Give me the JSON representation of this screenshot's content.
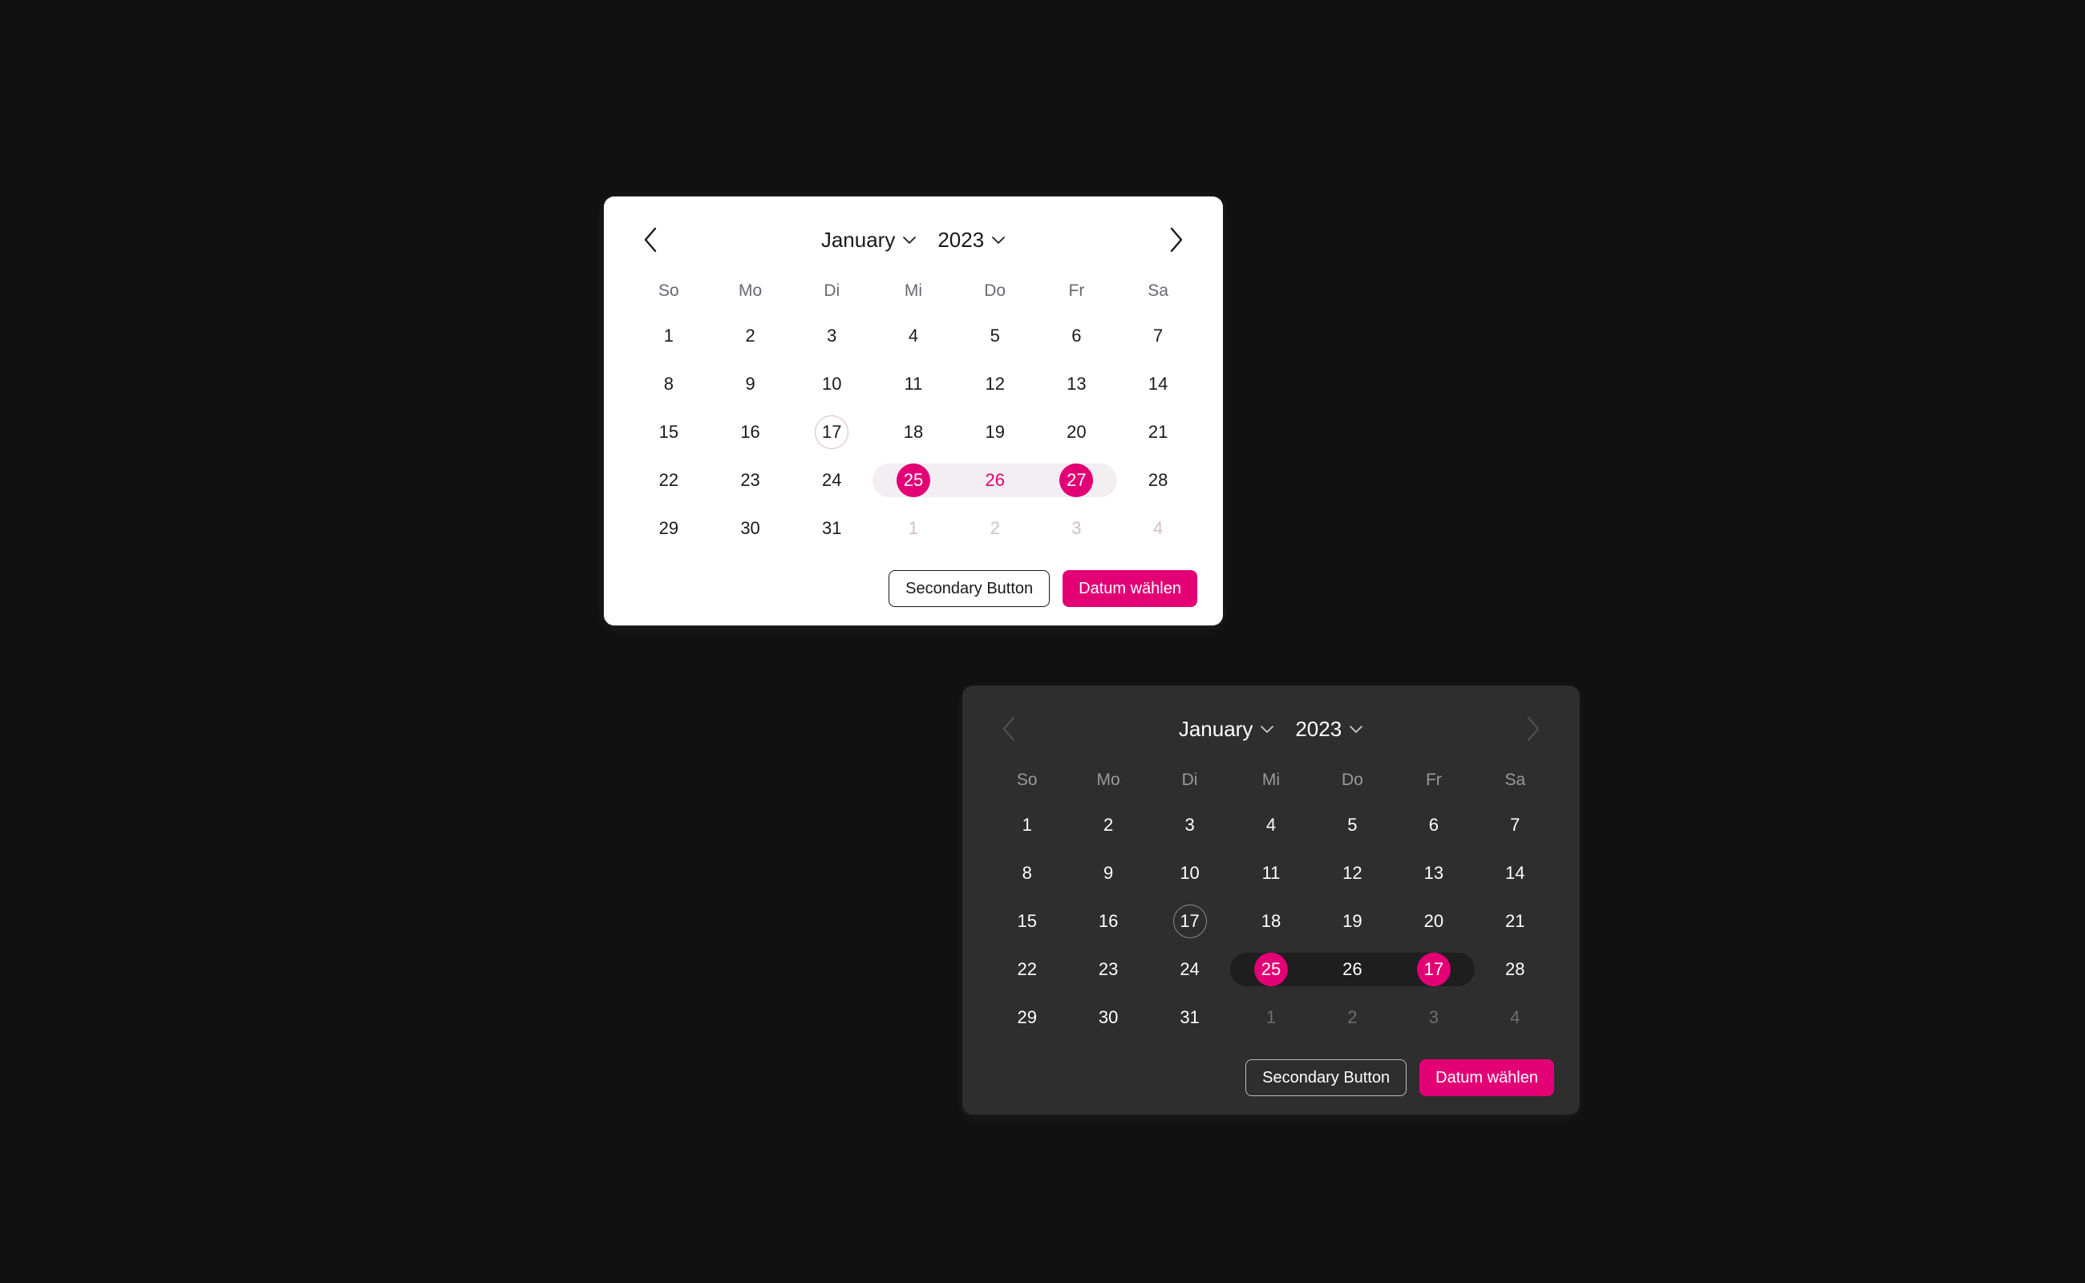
{
  "theme": {
    "page_background": "#111111",
    "accent": "#e20074",
    "light_card_background": "#ffffff",
    "dark_card_background": "#2e2e2e",
    "light_range_band": "#f3eef2",
    "dark_range_band": "#1e1e1e"
  },
  "weekdays": [
    "So",
    "Mo",
    "Di",
    "Mi",
    "Do",
    "Fr",
    "Sa"
  ],
  "icons": {
    "prev": "chevron-left-icon",
    "next": "chevron-right-icon",
    "dropdown": "chevron-down-icon"
  },
  "light_picker": {
    "header": {
      "month": "January",
      "year": "2023",
      "prev_label": "‹",
      "next_label": "›"
    },
    "weeks": [
      [
        {
          "label": "1",
          "state": "normal"
        },
        {
          "label": "2",
          "state": "normal"
        },
        {
          "label": "3",
          "state": "normal"
        },
        {
          "label": "4",
          "state": "normal"
        },
        {
          "label": "5",
          "state": "normal"
        },
        {
          "label": "6",
          "state": "normal"
        },
        {
          "label": "7",
          "state": "normal"
        }
      ],
      [
        {
          "label": "8",
          "state": "normal"
        },
        {
          "label": "9",
          "state": "normal"
        },
        {
          "label": "10",
          "state": "normal"
        },
        {
          "label": "11",
          "state": "normal"
        },
        {
          "label": "12",
          "state": "normal"
        },
        {
          "label": "13",
          "state": "normal"
        },
        {
          "label": "14",
          "state": "normal"
        }
      ],
      [
        {
          "label": "15",
          "state": "normal"
        },
        {
          "label": "16",
          "state": "normal"
        },
        {
          "label": "17",
          "state": "today"
        },
        {
          "label": "18",
          "state": "normal"
        },
        {
          "label": "19",
          "state": "normal"
        },
        {
          "label": "20",
          "state": "normal"
        },
        {
          "label": "21",
          "state": "normal"
        }
      ],
      [
        {
          "label": "22",
          "state": "normal"
        },
        {
          "label": "23",
          "state": "normal"
        },
        {
          "label": "24",
          "state": "normal"
        },
        {
          "label": "25",
          "state": "endpoint"
        },
        {
          "label": "26",
          "state": "range"
        },
        {
          "label": "27",
          "state": "endpoint"
        },
        {
          "label": "28",
          "state": "normal"
        }
      ],
      [
        {
          "label": "29",
          "state": "normal"
        },
        {
          "label": "30",
          "state": "normal"
        },
        {
          "label": "31",
          "state": "normal"
        },
        {
          "label": "1",
          "state": "muted"
        },
        {
          "label": "2",
          "state": "muted"
        },
        {
          "label": "3",
          "state": "muted"
        },
        {
          "label": "4",
          "state": "muted"
        }
      ]
    ],
    "range_row_index": 3,
    "range_start_col": 3,
    "range_end_col": 5,
    "footer": {
      "secondary_label": "Secondary Button",
      "primary_label": "Datum wählen"
    }
  },
  "dark_picker": {
    "header": {
      "month": "January",
      "year": "2023",
      "prev_label": "‹",
      "next_label": "›"
    },
    "weeks": [
      [
        {
          "label": "1",
          "state": "normal"
        },
        {
          "label": "2",
          "state": "normal"
        },
        {
          "label": "3",
          "state": "normal"
        },
        {
          "label": "4",
          "state": "normal"
        },
        {
          "label": "5",
          "state": "normal"
        },
        {
          "label": "6",
          "state": "normal"
        },
        {
          "label": "7",
          "state": "normal"
        }
      ],
      [
        {
          "label": "8",
          "state": "normal"
        },
        {
          "label": "9",
          "state": "normal"
        },
        {
          "label": "10",
          "state": "normal"
        },
        {
          "label": "11",
          "state": "normal"
        },
        {
          "label": "12",
          "state": "normal"
        },
        {
          "label": "13",
          "state": "normal"
        },
        {
          "label": "14",
          "state": "normal"
        }
      ],
      [
        {
          "label": "15",
          "state": "normal"
        },
        {
          "label": "16",
          "state": "normal"
        },
        {
          "label": "17",
          "state": "today"
        },
        {
          "label": "18",
          "state": "normal"
        },
        {
          "label": "19",
          "state": "normal"
        },
        {
          "label": "20",
          "state": "normal"
        },
        {
          "label": "21",
          "state": "normal"
        }
      ],
      [
        {
          "label": "22",
          "state": "normal"
        },
        {
          "label": "23",
          "state": "normal"
        },
        {
          "label": "24",
          "state": "normal"
        },
        {
          "label": "25",
          "state": "endpoint"
        },
        {
          "label": "26",
          "state": "range"
        },
        {
          "label": "17",
          "state": "endpoint"
        },
        {
          "label": "28",
          "state": "normal"
        }
      ],
      [
        {
          "label": "29",
          "state": "normal"
        },
        {
          "label": "30",
          "state": "normal"
        },
        {
          "label": "31",
          "state": "normal"
        },
        {
          "label": "1",
          "state": "muted"
        },
        {
          "label": "2",
          "state": "muted"
        },
        {
          "label": "3",
          "state": "muted"
        },
        {
          "label": "4",
          "state": "muted"
        }
      ]
    ],
    "range_row_index": 3,
    "range_start_col": 3,
    "range_end_col": 5,
    "footer": {
      "secondary_label": "Secondary Button",
      "primary_label": "Datum wählen"
    }
  }
}
